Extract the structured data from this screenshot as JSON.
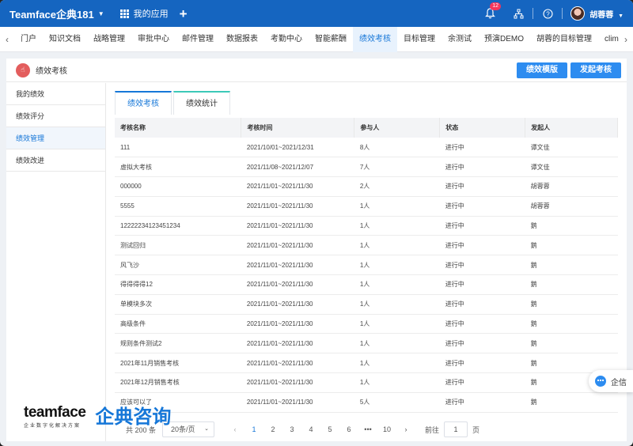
{
  "topbar": {
    "brand": "Teamface企典181",
    "apps_label": "我的应用",
    "notification_count": "12",
    "user_name": "胡蓉蓉"
  },
  "nav": {
    "items": [
      "门户",
      "知识文档",
      "战略管理",
      "审批中心",
      "邮件管理",
      "数据报表",
      "考勤中心",
      "智能薪酬",
      "绩效考核",
      "目标管理",
      "余测试",
      "预演DEMO",
      "胡蓉的目标管理",
      "clim",
      "v"
    ],
    "active_index": 8
  },
  "header": {
    "title": "绩效考核",
    "template_button": "绩效模版",
    "launch_button": "发起考核"
  },
  "sidebar": {
    "items": [
      "我的绩效",
      "绩效评分",
      "绩效管理",
      "绩效改进"
    ],
    "active_index": 2
  },
  "tabs": [
    "绩效考核",
    "绩效统计"
  ],
  "table": {
    "columns": [
      "考核名称",
      "考核时间",
      "参与人",
      "状态",
      "发起人"
    ],
    "rows": [
      [
        "111",
        "2021/10/01~2021/12/31",
        "8人",
        "进行中",
        "谭文佳"
      ],
      [
        "虚拟大考核",
        "2021/11/08~2021/12/07",
        "7人",
        "进行中",
        "谭文佳"
      ],
      [
        "000000",
        "2021/11/01~2021/11/30",
        "2人",
        "进行中",
        "胡蓉蓉"
      ],
      [
        "5555",
        "2021/11/01~2021/11/30",
        "1人",
        "进行中",
        "胡蓉蓉"
      ],
      [
        "12222234123451234",
        "2021/11/01~2021/11/30",
        "1人",
        "进行中",
        "鹅"
      ],
      [
        "测试回归",
        "2021/11/01~2021/11/30",
        "1人",
        "进行中",
        "鹅"
      ],
      [
        "风飞沙",
        "2021/11/01~2021/11/30",
        "1人",
        "进行中",
        "鹅"
      ],
      [
        "得得得得12",
        "2021/11/01~2021/11/30",
        "1人",
        "进行中",
        "鹅"
      ],
      [
        "单模块多次",
        "2021/11/01~2021/11/30",
        "1人",
        "进行中",
        "鹅"
      ],
      [
        "高级条件",
        "2021/11/01~2021/11/30",
        "1人",
        "进行中",
        "鹅"
      ],
      [
        "规则条件测试2",
        "2021/11/01~2021/11/30",
        "1人",
        "进行中",
        "鹅"
      ],
      [
        "2021年11月销售考核",
        "2021/11/01~2021/11/30",
        "1人",
        "进行中",
        "鹅"
      ],
      [
        "2021年12月销售考核",
        "2021/11/01~2021/11/30",
        "1人",
        "进行中",
        "鹅"
      ],
      [
        "应该可以了",
        "2021/11/01~2021/11/30",
        "5人",
        "进行中",
        "鹅"
      ]
    ]
  },
  "pager": {
    "total": "共 200 条",
    "page_size": "20条/页",
    "pages": [
      "1",
      "2",
      "3",
      "4",
      "5",
      "6",
      "•••",
      "10"
    ],
    "current_page": "1",
    "goto_label": "前往",
    "goto_value": "1",
    "page_suffix": "页"
  },
  "watermark": {
    "brand": "teamface",
    "sub": "企业数字化解决方案",
    "cn": "企典咨询"
  },
  "chat": {
    "label": "企信"
  }
}
